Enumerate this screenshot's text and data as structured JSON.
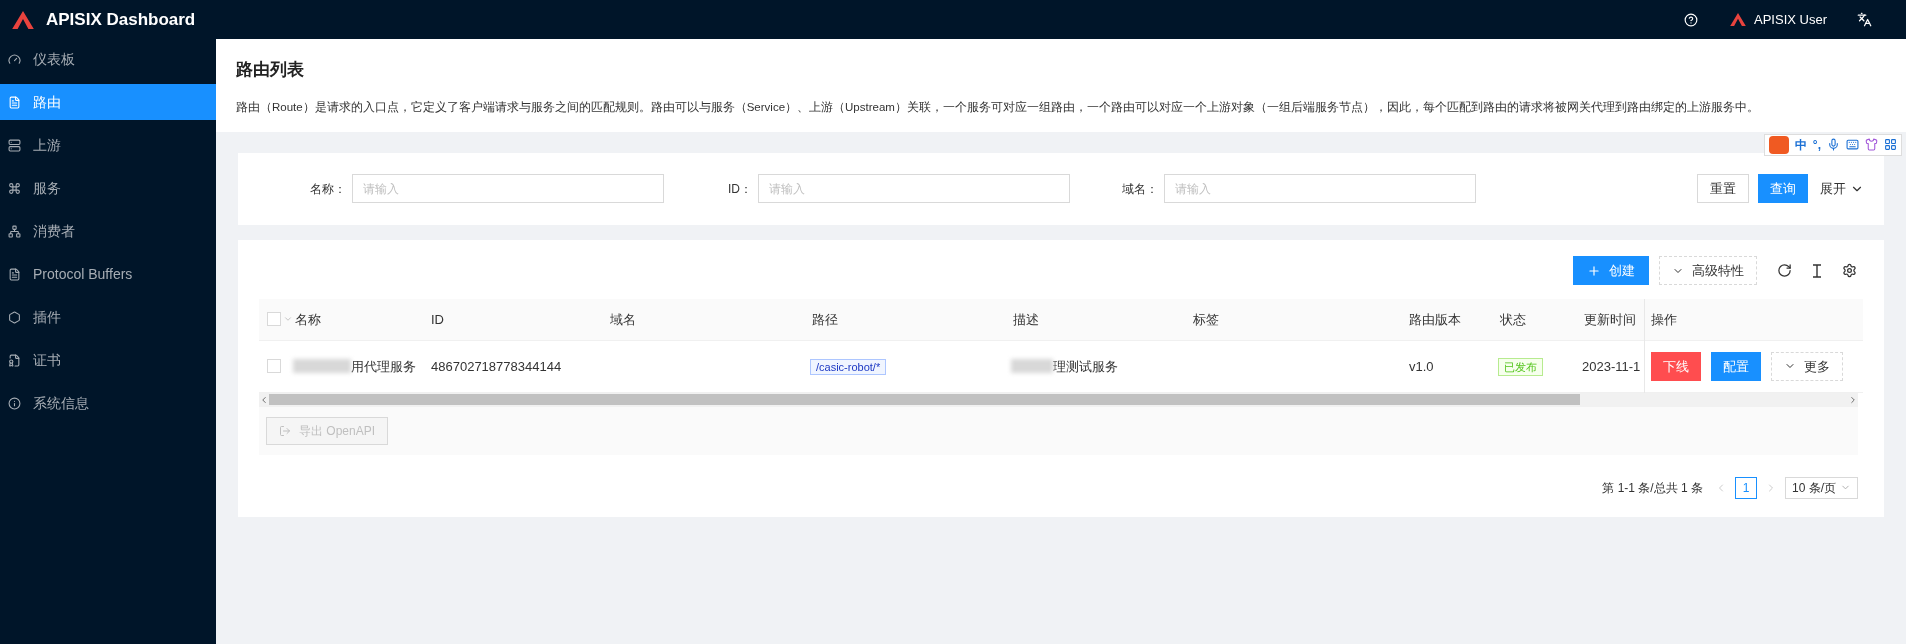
{
  "header": {
    "title": "APISIX Dashboard",
    "user": "APISIX User"
  },
  "sidebar": {
    "items": [
      {
        "label": "仪表板",
        "selected": false
      },
      {
        "label": "路由",
        "selected": true
      },
      {
        "label": "上游",
        "selected": false
      },
      {
        "label": "服务",
        "selected": false
      },
      {
        "label": "消费者",
        "selected": false
      },
      {
        "label": "Protocol Buffers",
        "selected": false
      },
      {
        "label": "插件",
        "selected": false
      },
      {
        "label": "证书",
        "selected": false
      },
      {
        "label": "系统信息",
        "selected": false
      }
    ]
  },
  "page": {
    "title": "路由列表",
    "description": "路由（Route）是请求的入口点，它定义了客户端请求与服务之间的匹配规则。路由可以与服务（Service）、上游（Upstream）关联，一个服务可对应一组路由，一个路由可以对应一个上游对象（一组后端服务节点），因此，每个匹配到路由的请求将被网关代理到路由绑定的上游服务中。"
  },
  "filters": {
    "fields": [
      {
        "label": "名称：",
        "placeholder": "请输入"
      },
      {
        "label": "ID：",
        "placeholder": "请输入"
      },
      {
        "label": "域名：",
        "placeholder": "请输入"
      }
    ],
    "reset": "重置",
    "search": "查询",
    "expand": "展开"
  },
  "toolbar": {
    "create": "创建",
    "advanced": "高级特性"
  },
  "table": {
    "all_checked": false,
    "columns": [
      "名称",
      "ID",
      "域名",
      "路径",
      "描述",
      "标签",
      "路由版本",
      "状态",
      "更新时间",
      "操作"
    ],
    "rows": [
      {
        "checked": false,
        "name": "用代理服务",
        "id": "486702718778344144",
        "path": "/casic-robot/*",
        "description": "理测试服务",
        "version": "v1.0",
        "status": "已发布",
        "updated": "2023-11-1",
        "actions": [
          {
            "label": "下线",
            "kind": "danger"
          },
          {
            "label": "配置",
            "kind": "primary"
          },
          {
            "label": "更多",
            "kind": "more"
          }
        ]
      }
    ]
  },
  "export": {
    "label": "导出 OpenAPI",
    "disabled": true
  },
  "pagination": {
    "summary": "第 1-1 条/总共 1 条",
    "pages": [
      {
        "label": "1",
        "selected": true
      }
    ],
    "page_size": "10 条/页"
  },
  "ime": {
    "mode": "中",
    "punctuation": "°,"
  }
}
